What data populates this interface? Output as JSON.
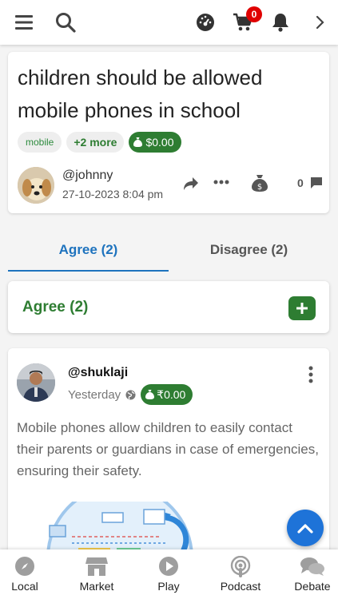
{
  "header": {
    "cart_count": "0"
  },
  "question": {
    "title": "children should be allowed mobile phones in school",
    "tags": [
      "mobile"
    ],
    "more_tags": "+2 more",
    "bounty": "$0.00",
    "author": "@johnny",
    "date": "27-10-2023 8:04 pm",
    "comment_count": "0"
  },
  "tabs": [
    {
      "label": "Agree (2)",
      "active": true
    },
    {
      "label": "Disagree (2)",
      "active": false
    }
  ],
  "agree_section": {
    "title": "Agree (2)"
  },
  "argument": {
    "author": "@shuklaji",
    "time": "Yesterday",
    "bounty": "₹0.00",
    "text": "Mobile phones allow children to easily contact their parents or guardians in case of emergencies, ensuring their safety."
  },
  "bottom_nav": [
    {
      "label": "Local",
      "icon": "compass-icon"
    },
    {
      "label": "Market",
      "icon": "store-icon"
    },
    {
      "label": "Play",
      "icon": "play-icon"
    },
    {
      "label": "Podcast",
      "icon": "podcast-icon"
    },
    {
      "label": "Debate",
      "icon": "chat-bubbles-icon"
    }
  ],
  "colors": {
    "accent_blue": "#1e73be",
    "green": "#2e7d32",
    "badge_red": "#e00000"
  }
}
